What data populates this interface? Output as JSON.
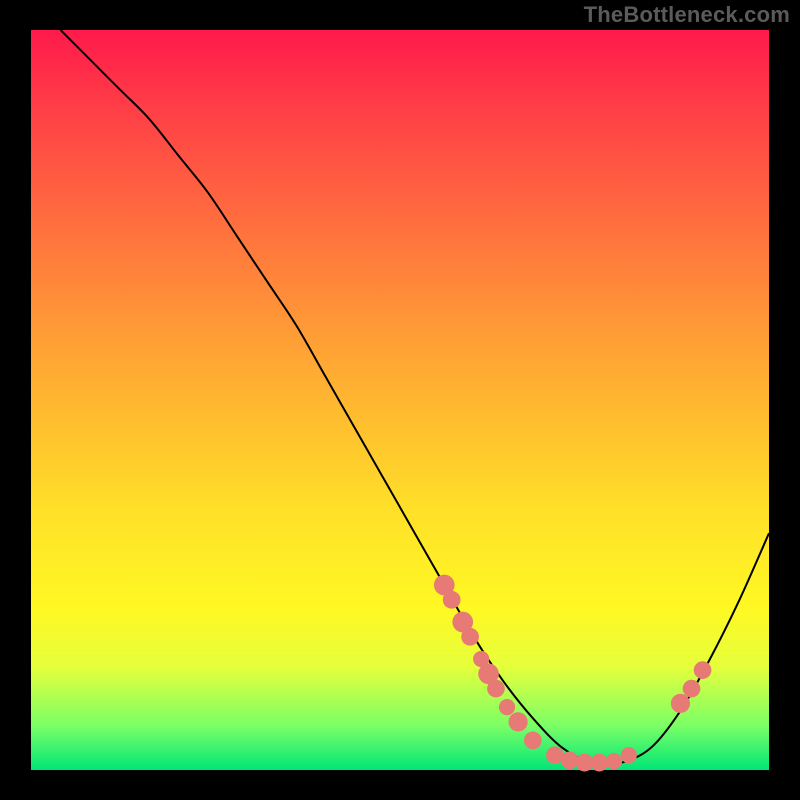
{
  "watermark": "TheBottleneck.com",
  "chart_data": {
    "type": "line",
    "title": "",
    "xlabel": "",
    "ylabel": "",
    "xlim": [
      0,
      100
    ],
    "ylim": [
      0,
      100
    ],
    "series": [
      {
        "name": "curve",
        "x": [
          4,
          8,
          12,
          16,
          20,
          24,
          28,
          32,
          36,
          40,
          44,
          48,
          52,
          56,
          60,
          64,
          68,
          72,
          76,
          80,
          84,
          88,
          92,
          96,
          100
        ],
        "y": [
          100,
          96,
          92,
          88,
          83,
          78,
          72,
          66,
          60,
          53,
          46,
          39,
          32,
          25,
          18,
          12,
          7,
          3,
          1,
          1,
          3,
          8,
          15,
          23,
          32
        ]
      }
    ],
    "markers": [
      {
        "x": 56,
        "y": 25,
        "r": 1.4
      },
      {
        "x": 57,
        "y": 23,
        "r": 1.2
      },
      {
        "x": 58.5,
        "y": 20,
        "r": 1.4
      },
      {
        "x": 59.5,
        "y": 18,
        "r": 1.2
      },
      {
        "x": 61,
        "y": 15,
        "r": 1.1
      },
      {
        "x": 62,
        "y": 13,
        "r": 1.4
      },
      {
        "x": 63,
        "y": 11,
        "r": 1.2
      },
      {
        "x": 64.5,
        "y": 8.5,
        "r": 1.1
      },
      {
        "x": 66,
        "y": 6.5,
        "r": 1.3
      },
      {
        "x": 68,
        "y": 4,
        "r": 1.2
      },
      {
        "x": 71,
        "y": 2,
        "r": 1.2
      },
      {
        "x": 73,
        "y": 1.3,
        "r": 1.2
      },
      {
        "x": 75,
        "y": 1,
        "r": 1.2
      },
      {
        "x": 77,
        "y": 1,
        "r": 1.2
      },
      {
        "x": 79,
        "y": 1.2,
        "r": 1.1
      },
      {
        "x": 81,
        "y": 2,
        "r": 1.1
      },
      {
        "x": 88,
        "y": 9,
        "r": 1.3
      },
      {
        "x": 89.5,
        "y": 11,
        "r": 1.2
      },
      {
        "x": 91,
        "y": 13.5,
        "r": 1.2
      }
    ],
    "gradient_stops": [
      {
        "pos": 0,
        "color": "#ff1a4b"
      },
      {
        "pos": 25,
        "color": "#ff6b3f"
      },
      {
        "pos": 65,
        "color": "#ffe028"
      },
      {
        "pos": 94,
        "color": "#7bff66"
      },
      {
        "pos": 100,
        "color": "#00e676"
      }
    ]
  }
}
